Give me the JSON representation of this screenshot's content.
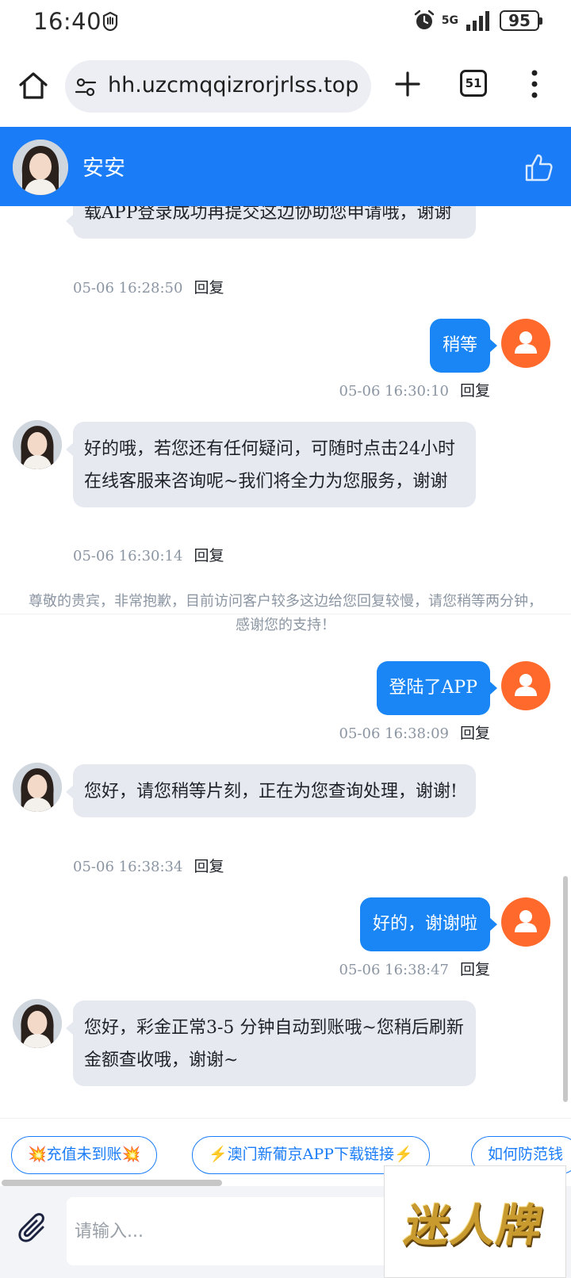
{
  "status_bar": {
    "time": "16:40",
    "network": "5G",
    "battery": "95",
    "icons": [
      "hand-icon",
      "alarm-icon",
      "signal-icon",
      "battery-icon"
    ]
  },
  "browser": {
    "url": "hh.uzcmqqizrorjrlss.top",
    "tab_count": "51",
    "icons": [
      "home-icon",
      "site-info-icon",
      "new-tab-icon",
      "tabs-icon",
      "more-menu-icon"
    ]
  },
  "chat_header": {
    "agent_name": "安安",
    "icons": [
      "agent-avatar",
      "thumbs-up-icon"
    ]
  },
  "messages": [
    {
      "id": "m1",
      "from": "agent",
      "text": "载APP登录成功再提交这边协助您申请哦，谢谢",
      "time": "05-06 16:28:50",
      "action": "回复"
    },
    {
      "id": "m2",
      "from": "user",
      "text": "稍等",
      "time": "05-06 16:30:10",
      "action": "回复"
    },
    {
      "id": "m3",
      "from": "agent",
      "text": "好的哦，若您还有任何疑问，可随时点击24小时在线客服来咨询呢~我们将全力为您服务，谢谢",
      "time": "05-06 16:30:14",
      "action": "回复"
    },
    {
      "id": "m4",
      "from": "system",
      "text": "尊敬的贵宾，非常抱歉，目前访问客户较多这边给您回复较慢，请您稍等两分钟，感谢您的支持！"
    },
    {
      "id": "m5",
      "from": "user",
      "text": "登陆了APP",
      "time": "05-06 16:38:09",
      "action": "回复"
    },
    {
      "id": "m6",
      "from": "agent",
      "text": "您好，请您稍等片刻，正在为您查询处理，谢谢!",
      "time": "05-06 16:38:34",
      "action": "回复"
    },
    {
      "id": "m7",
      "from": "user",
      "text": "好的，谢谢啦",
      "time": "05-06 16:38:47",
      "action": "回复"
    },
    {
      "id": "m8",
      "from": "agent",
      "text": "您好，彩金正常3-5 分钟自动到账哦~您稍后刷新金额查收哦，谢谢~"
    }
  ],
  "quick_replies": [
    "💥充值未到账💥",
    "⚡澳门新葡京APP下载链接⚡",
    "如何防范钱"
  ],
  "input": {
    "placeholder": "请输入..."
  },
  "overlay_logo": {
    "text": "迷人牌"
  },
  "colors": {
    "brand_blue": "#1a7cf7",
    "user_bubble": "#1a86f5",
    "agent_bubble": "#e6eaf0",
    "user_avatar": "#ff6a2c",
    "meta_gray": "#8c96a3"
  }
}
